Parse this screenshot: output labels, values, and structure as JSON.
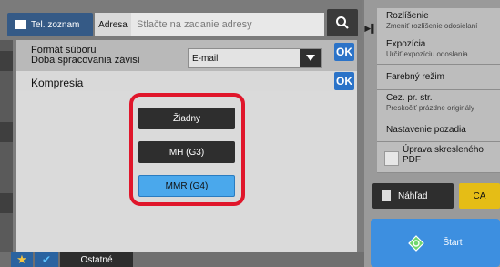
{
  "topbar": {
    "address_book_tab": "Tel. zoznam",
    "address_label": "Adresa",
    "address_placeholder": "Stlačte na zadanie adresy"
  },
  "dialog": {
    "format_label_line1": "Formát súboru",
    "format_label_line2": "Doba spracovania závisí",
    "format_value": "E-mail",
    "ok_label": "OK",
    "kompresia_title": "Kompresia",
    "options": [
      "Žiadny",
      "MH (G3)",
      "MMR (G4)"
    ],
    "selected_option": "MMR (G4)"
  },
  "bottom": {
    "ostatne_label": "Ostatné"
  },
  "right_panel": {
    "menu": [
      {
        "title": "Rozlíšenie",
        "subtitle": "Zmeniť rozlíšenie odosielaní"
      },
      {
        "title": "Expozícia",
        "subtitle": "Určiť expozíciu odoslania"
      },
      {
        "title": "Farebný režim",
        "subtitle": ""
      },
      {
        "title": "Cez. pr. str.",
        "subtitle": "Preskočiť prázdne originály"
      },
      {
        "title": "Nastavenie pozadia",
        "subtitle": ""
      },
      {
        "title": "Úprava skresleného PDF",
        "subtitle": ""
      }
    ],
    "preview_label": "Náhľad",
    "ca_label": "CA",
    "start_label": "Štart"
  },
  "colors": {
    "accent_blue": "#2b73c8",
    "selected_option": "#4aa8ec",
    "highlight_red": "#e0162b",
    "ca_yellow": "#e5bd16",
    "start_blue": "#3d8fe0"
  },
  "icons": [
    "address-book-icon",
    "search-icon",
    "dropdown-arrow-icon",
    "collapse-arrow-icon",
    "star-icon",
    "checkmark-icon",
    "preview-icon",
    "start-icon"
  ]
}
